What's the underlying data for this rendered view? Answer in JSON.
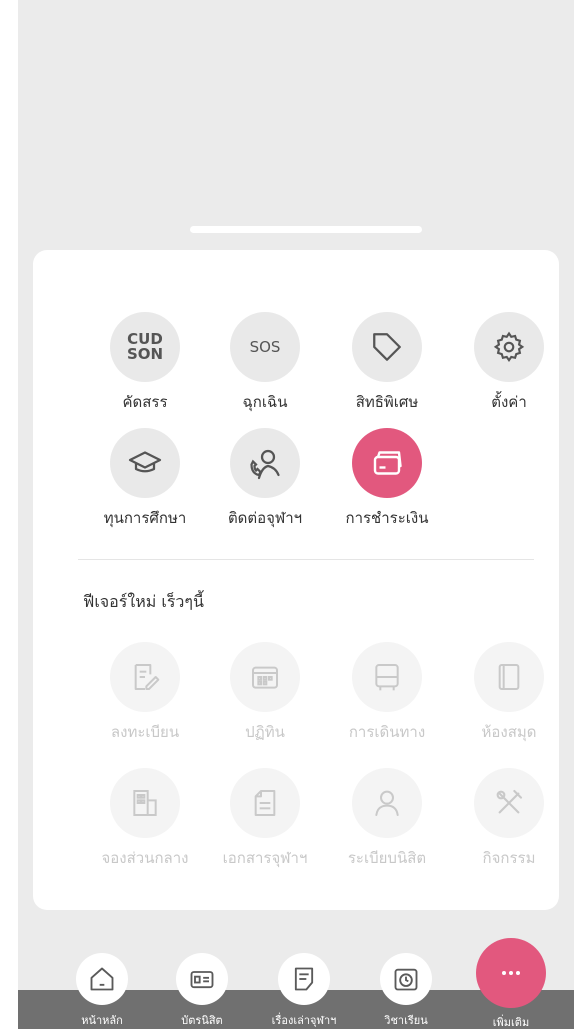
{
  "sheet": {
    "main_items": [
      {
        "label": "คัดสรร",
        "icon_text": "CUD\nSON",
        "icon": "cudson-icon"
      },
      {
        "label": "ฉุกเฉิน",
        "icon_text": "SOS",
        "icon": "sos-icon"
      },
      {
        "label": "สิทธิพิเศษ",
        "icon": "tag-icon"
      },
      {
        "label": "ตั้งค่า",
        "icon": "gear-icon"
      },
      {
        "label": "ทุนการศึกษา",
        "icon": "graduation-cap-icon"
      },
      {
        "label": "ติดต่อจุฬาฯ",
        "icon": "contact-phone-icon"
      },
      {
        "label": "การชำระเงิน",
        "icon": "payment-cards-icon"
      }
    ],
    "section_title": "ฟีเจอร์ใหม่ เร็วๆนี้",
    "coming_items": [
      {
        "label": "ลงทะเบียน",
        "icon": "edit-document-icon"
      },
      {
        "label": "ปฏิทิน",
        "icon": "calendar-icon"
      },
      {
        "label": "การเดินทาง",
        "icon": "bus-icon"
      },
      {
        "label": "ห้องสมุด",
        "icon": "book-icon"
      },
      {
        "label": "จองส่วนกลาง",
        "icon": "building-icon"
      },
      {
        "label": "เอกสารจุฬาฯ",
        "icon": "document-icon"
      },
      {
        "label": "ระเบียบนิสิต",
        "icon": "person-icon"
      },
      {
        "label": "กิจกรรม",
        "icon": "tools-icon"
      }
    ]
  },
  "tabbar": {
    "tabs": [
      {
        "label": "หน้าหลัก",
        "icon": "home-icon"
      },
      {
        "label": "บัตรนิสิต",
        "icon": "id-card-icon"
      },
      {
        "label": "เรื่องเล่าจุฬาฯ",
        "icon": "story-icon"
      },
      {
        "label": "วิชาเรียน",
        "icon": "class-clock-icon"
      },
      {
        "label": "เพิ่มเติม",
        "icon": "more-icon"
      }
    ]
  },
  "colors": {
    "accent": "#e2587e",
    "backdrop": "#ebebeb",
    "tabbar": "#707070"
  }
}
